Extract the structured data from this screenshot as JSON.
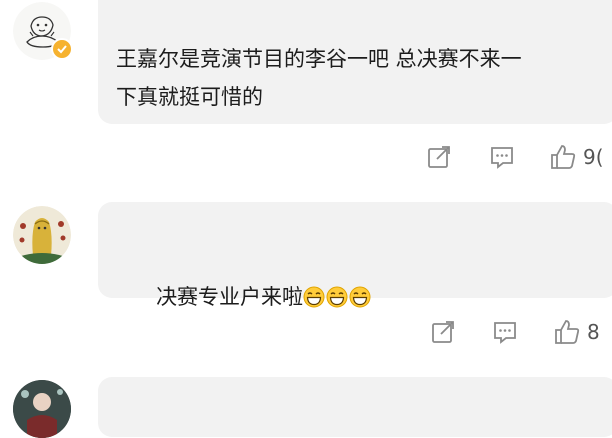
{
  "comments": [
    {
      "text_lines": [
        "王嘉尔是竞演节目的李谷一吧 总决赛不来一",
        "下真就挺可惜的"
      ],
      "like_count": "9(",
      "verified_badge_color": "#f6b22f",
      "icons": [
        "share-icon",
        "comment-icon",
        "like-icon"
      ]
    },
    {
      "text": "决赛专业户来啦",
      "emojis": [
        "grin-emoji",
        "grin-emoji",
        "grin-emoji"
      ],
      "like_count": "8",
      "icons": [
        "share-icon",
        "comment-icon",
        "like-icon"
      ]
    }
  ],
  "colors": {
    "bubble_bg": "#f2f2f2",
    "icon_gray": "#888888",
    "text": "#1c1c1c"
  }
}
